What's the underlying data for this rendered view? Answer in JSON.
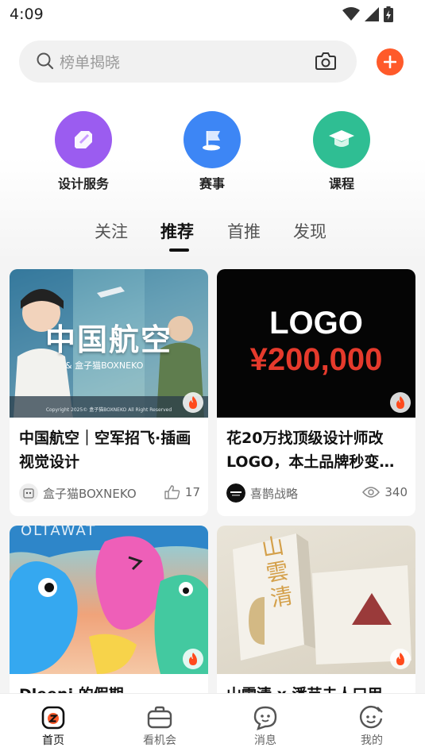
{
  "status_bar": {
    "time": "4:09"
  },
  "search": {
    "placeholder": "榜单揭晓"
  },
  "quick_links": [
    {
      "label": "设计服务",
      "icon": "pen-icon",
      "color": "#9b5cf0"
    },
    {
      "label": "赛事",
      "icon": "flag-icon",
      "color": "#3d86f5"
    },
    {
      "label": "课程",
      "icon": "graduation-cap-icon",
      "color": "#2fbe93"
    }
  ],
  "tabs": [
    {
      "label": "关注",
      "active": false
    },
    {
      "label": "推荐",
      "active": true
    },
    {
      "label": "首推",
      "active": false
    },
    {
      "label": "发现",
      "active": false
    }
  ],
  "cards": [
    {
      "title": "中国航空｜空军招飞·插画视觉设计",
      "image_title": "中国航空",
      "image_subtitle": "& 盒子猫BOXNEKO",
      "image_footer": "Copyright 2025© 盒子猫BOXNEKO All Right Reserved",
      "author": "盒子猫BOXNEKO",
      "stat_icon": "thumb-up-icon",
      "stat_value": "17"
    },
    {
      "title": "花20万找顶级设计师改LOGO，本土品牌秒变…",
      "image_line1": "LOGO",
      "image_line2": "¥200,000",
      "author": "喜鹊战略",
      "stat_icon": "eye-icon",
      "stat_value": "340"
    },
    {
      "title": "Dleeni 的假期",
      "image_text": "OLTAWAT",
      "author": "",
      "stat_value": ""
    },
    {
      "title": "山雲清 x 潘芸夫人口用",
      "image_text": "山雲清",
      "author": "",
      "stat_value": ""
    }
  ],
  "bottom_nav": [
    {
      "label": "首页",
      "icon": "home-icon",
      "active": true
    },
    {
      "label": "看机会",
      "icon": "briefcase-icon",
      "active": false
    },
    {
      "label": "消息",
      "icon": "message-icon",
      "active": false
    },
    {
      "label": "我的",
      "icon": "profile-icon",
      "active": false
    }
  ],
  "colors": {
    "accent": "#ff5a2a",
    "fire": "#ff4a1c"
  }
}
